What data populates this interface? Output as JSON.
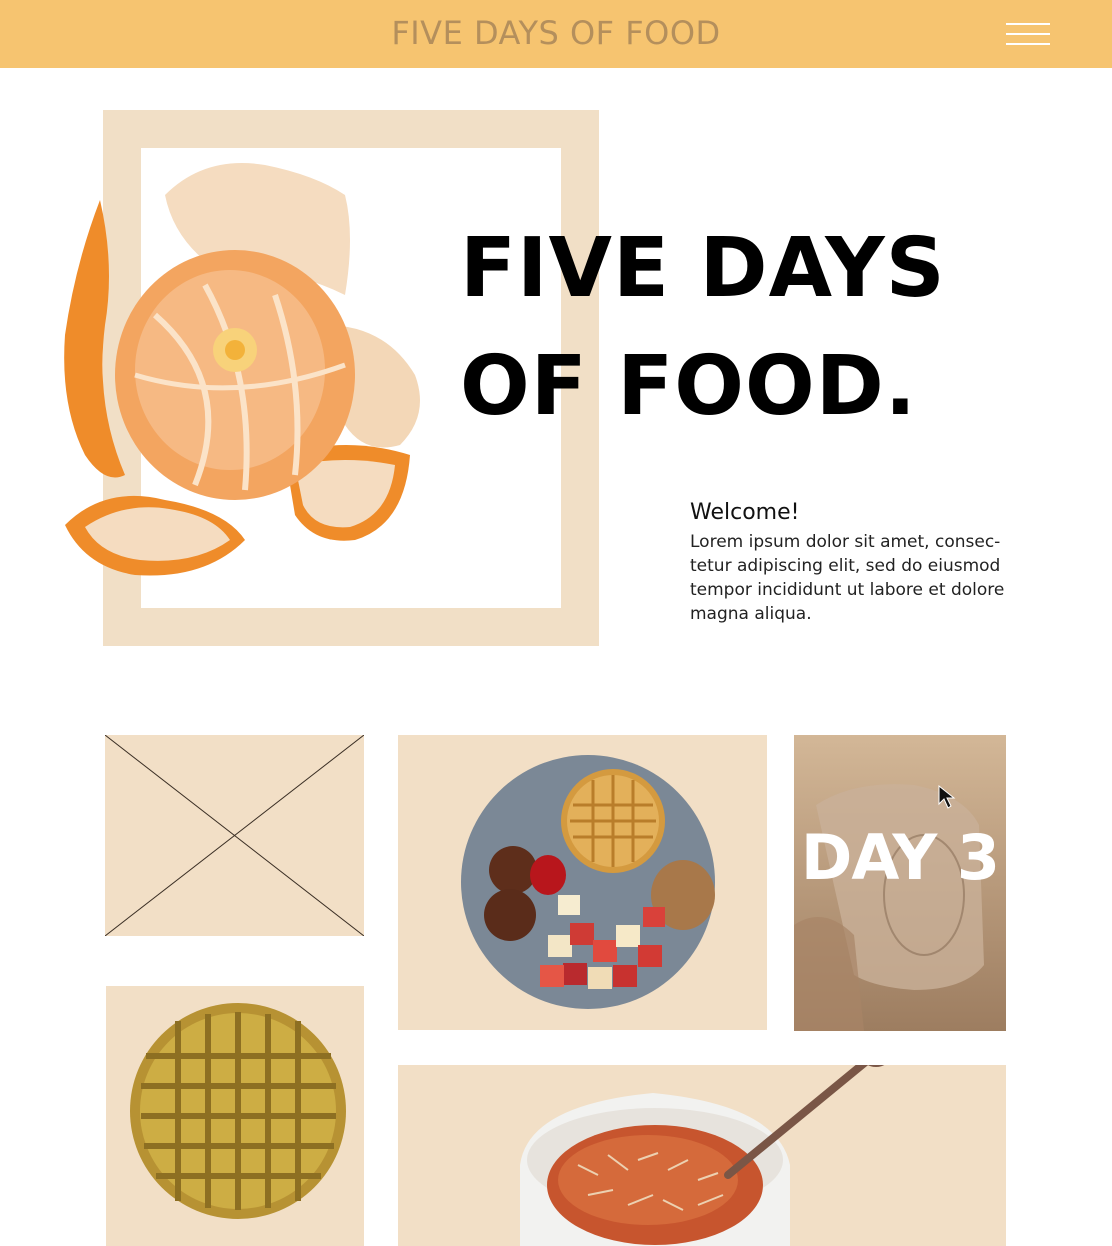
{
  "header": {
    "brand": "FIVE DAYS OF FOOD",
    "menu_icon": "hamburger-menu-icon"
  },
  "hero": {
    "title": "FIVE DAYS OF FOOD.",
    "image_icon": "peeled-orange-illustration"
  },
  "welcome": {
    "title": "Welcome!",
    "body": "Lorem ipsum dolor sit amet, consec-tetur adipiscing elit, sed do eiusmod tempor incididunt ut labore et dolore magna aliqua."
  },
  "gallery": {
    "placeholder_icon": "image-placeholder-icon",
    "plate_icon": "breakfast-plate-illustration",
    "day_label": "DAY 3",
    "waffle_icon": "waffle-illustration",
    "pasta_icon": "pasta-bowl-illustration",
    "cursor_icon": "mouse-pointer-icon"
  },
  "colors": {
    "header_bg": "#f6c470",
    "brand_text": "#b48f5c",
    "tile_bg": "#f2dfc6",
    "frame_bg": "#f1dfc6"
  }
}
